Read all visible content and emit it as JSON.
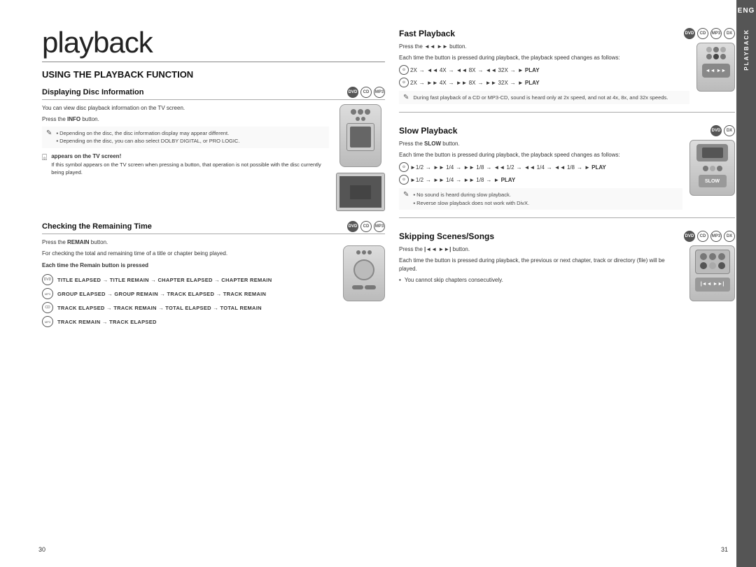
{
  "page": {
    "title": "playback",
    "subtitle": "USING THE PLAYBACK FUNCTION",
    "page_left": "30",
    "page_right": "31"
  },
  "sidebar": {
    "eng_label": "ENG",
    "playback_label": "PLAYBACK"
  },
  "left": {
    "displaying_disc": {
      "title": "Displaying Disc Information",
      "disc_icons": [
        "DVD",
        "CD",
        "MP3"
      ],
      "body1": "You can view disc playback information  on the TV screen.",
      "press_info": "Press the INFO button.",
      "notes": [
        "Depending on the disc, the disc information display may appear different.",
        "Depending on the disc, you can also select DOLBY DIGITAL, or PRO LOGIC."
      ],
      "tv_symbol_title": "appears on the TV screen!",
      "tv_symbol_text": "If this symbol appears on the TV screen when pressing a button, that operation is not possible with the disc currently being played."
    },
    "checking_remaining": {
      "title": "Checking the Remaining Time",
      "disc_icons": [
        "DVD",
        "CD",
        "MP3"
      ],
      "press_text": "Press the REMAIN button.",
      "body": "For checking the total and remaining time of a title or chapter being played.",
      "sub_title": "Each time the Remain button is pressed",
      "sequences": [
        "TITLE ELAPSED → TITLE REMAIN → CHAPTER ELAPSED → CHAPTER REMAIN",
        "GROUP ELAPSED → GROUP REMAIN → TRACK ELAPSED → TRACK REMAIN",
        "TRACK ELAPSED → TRACK REMAIN → TOTAL ELAPSED → TOTAL REMAIN",
        "TRACK REMAIN → TRACK ELAPSED"
      ],
      "seq_icons": [
        "DVD",
        "MP3-CD",
        "CD",
        "MP3"
      ]
    }
  },
  "right": {
    "fast_playback": {
      "title": "Fast Playback",
      "disc_icons": [
        "DVD",
        "CD",
        "MP3",
        "DivX"
      ],
      "press_text": "Press the ◄◄  ►► button.",
      "body": "Each time the button is pressed during playback, the playback speed changes as follows:",
      "sequence1": "⊙ 2X → ◄◄ 4X → ◄◄ 8X → ◄◄ 32X → ► PLAY",
      "sequence2": "⊙ 2X → ►► 4X → ►► 8X → ►► 32X → ► PLAY",
      "note": "During fast playback of a CD or MP3-CD, sound is heard only at 2x speed, and not at 4x, 8x, and 32x speeds."
    },
    "slow_playback": {
      "title": "Slow Playback",
      "disc_icons": [
        "DVD",
        "DivX"
      ],
      "press_text": "Press the SLOW button.",
      "body": "Each time the button is pressed during playback, the playback speed changes as follows:",
      "sequence1": "⊙ ►1/2 →►► 1/4 →►► 1/8 →◄◄ 1/2 →◄◄ 1/4 →◄◄ 1/8 → ► PLAY",
      "sequence2": "⊙ ►1/2 →►► 1/4 →►► 1/8 → ► PLAY",
      "notes": [
        "No sound is heard during slow playback.",
        "Reverse slow playback does not work with DivX."
      ]
    },
    "skipping": {
      "title": "Skipping Scenes/Songs",
      "disc_icons": [
        "DVD",
        "CD",
        "MP3",
        "DivX"
      ],
      "press_text": "Press the |◄◄  ►►| button.",
      "body": "Each time the button is pressed during playback, the previous or next chapter, track or directory (file) will be played.",
      "note": "You cannot skip chapters consecutively."
    }
  }
}
